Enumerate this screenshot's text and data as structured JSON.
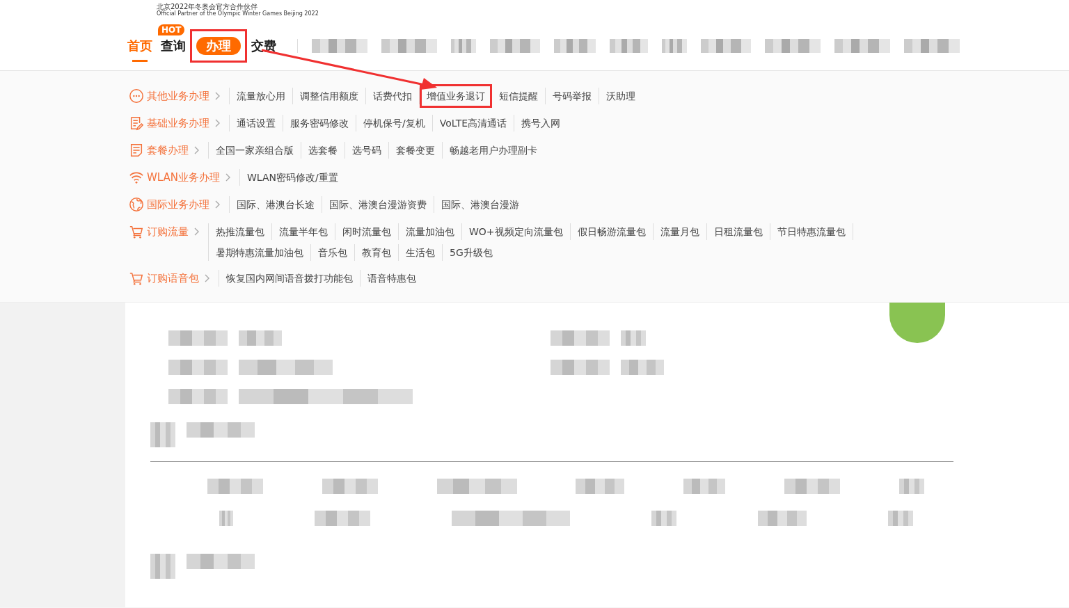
{
  "logo": {
    "line_1": "北京2022年冬奥会官方合作伙伴",
    "line_2": "Official Partner of the Olympic Winter Games Beijing 2022"
  },
  "nav": [
    {
      "label": "首页",
      "selected": true,
      "open": false,
      "highlighted": false
    },
    {
      "label": "查询",
      "selected": false,
      "open": false,
      "highlighted": false,
      "badge": "HOT"
    },
    {
      "label": "办理",
      "selected": false,
      "open": true,
      "highlighted": true
    },
    {
      "label": "交费",
      "selected": false,
      "open": false,
      "highlighted": false
    }
  ],
  "menu": [
    {
      "kind": "more",
      "label": "其他业务办理",
      "items": [
        {
          "label": "流量放心用",
          "highlighted": false
        },
        {
          "label": "调整信用额度",
          "highlighted": false
        },
        {
          "label": "话费代扣",
          "highlighted": false
        },
        {
          "label": "增值业务退订",
          "highlighted": true
        },
        {
          "label": "短信提醒",
          "highlighted": false
        },
        {
          "label": "号码举报",
          "highlighted": false
        },
        {
          "label": "沃助理",
          "highlighted": false
        }
      ]
    },
    {
      "kind": "edit",
      "label": "基础业务办理",
      "items": [
        {
          "label": "通话设置",
          "highlighted": false
        },
        {
          "label": "服务密码修改",
          "highlighted": false
        },
        {
          "label": "停机保号/复机",
          "highlighted": false
        },
        {
          "label": "VoLTE高清通话",
          "highlighted": false
        },
        {
          "label": "携号入网",
          "highlighted": false
        }
      ]
    },
    {
      "kind": "doc",
      "label": "套餐办理",
      "items": [
        {
          "label": "全国一家亲组合版",
          "highlighted": false
        },
        {
          "label": "选套餐",
          "highlighted": false
        },
        {
          "label": "选号码",
          "highlighted": false
        },
        {
          "label": "套餐变更",
          "highlighted": false
        },
        {
          "label": "畅越老用户办理副卡",
          "highlighted": false
        }
      ]
    },
    {
      "kind": "wifi",
      "label": "WLAN业务办理",
      "items": [
        {
          "label": "WLAN密码修改/重置",
          "highlighted": false
        }
      ]
    },
    {
      "kind": "globe",
      "label": "国际业务办理",
      "items": [
        {
          "label": "国际、港澳台长途",
          "highlighted": false
        },
        {
          "label": "国际、港澳台漫游资费",
          "highlighted": false
        },
        {
          "label": "国际、港澳台漫游",
          "highlighted": false
        }
      ]
    },
    {
      "kind": "cart",
      "label": "订购流量",
      "items": [
        {
          "label": "热推流量包",
          "highlighted": false
        },
        {
          "label": "流量半年包",
          "highlighted": false
        },
        {
          "label": "闲时流量包",
          "highlighted": false
        },
        {
          "label": "流量加油包",
          "highlighted": false
        },
        {
          "label": "WO+视频定向流量包",
          "highlighted": false
        },
        {
          "label": "假日畅游流量包",
          "highlighted": false
        },
        {
          "label": "流量月包",
          "highlighted": false
        },
        {
          "label": "日租流量包",
          "highlighted": false
        },
        {
          "label": "节日特惠流量包",
          "highlighted": false
        },
        {
          "label": "暑期特惠流量加油包",
          "highlighted": false
        },
        {
          "label": "音乐包",
          "highlighted": false
        },
        {
          "label": "教育包",
          "highlighted": false
        },
        {
          "label": "生活包",
          "highlighted": false
        },
        {
          "label": "5G升级包",
          "highlighted": false
        }
      ]
    },
    {
      "kind": "cart",
      "label": "订购语音包",
      "items": [
        {
          "label": "恢复国内网间语音拨打功能包",
          "highlighted": false
        },
        {
          "label": "语音特惠包",
          "highlighted": false
        }
      ]
    }
  ]
}
